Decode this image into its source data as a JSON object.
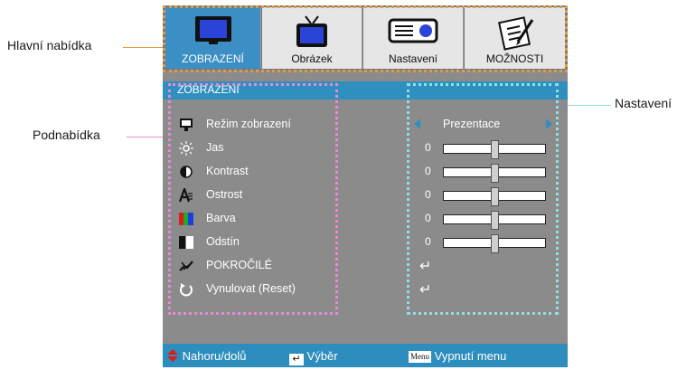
{
  "callouts": {
    "main_menu": "Hlavní nabídka",
    "submenu": "Podnabídka",
    "settings": "Nastavení"
  },
  "tabs": [
    {
      "label": "ZOBRAZENÍ",
      "icon": "monitor-icon",
      "active": true
    },
    {
      "label": "Obrázek",
      "icon": "tv-icon",
      "active": false
    },
    {
      "label": "Nastavení",
      "icon": "projector-icon",
      "active": false
    },
    {
      "label": "MOŽNOSTI",
      "icon": "notepad-pen-icon",
      "active": false
    }
  ],
  "section_title": "ZOBRAZENÍ",
  "rows": [
    {
      "label": "Režim zobrazení",
      "icon": "monitor-small-icon",
      "value": "Prezentace",
      "type": "select"
    },
    {
      "label": "Jas",
      "icon": "sun-icon",
      "value": "0",
      "type": "slider",
      "level": 0.5
    },
    {
      "label": "Kontrast",
      "icon": "contrast-icon",
      "value": "0",
      "type": "slider",
      "level": 0.5
    },
    {
      "label": "Ostrost",
      "icon": "sharpness-icon",
      "value": "0",
      "type": "slider",
      "level": 0.5
    },
    {
      "label": "Barva",
      "icon": "color-bars-icon",
      "value": "0",
      "type": "slider",
      "level": 0.5
    },
    {
      "label": "Odstín",
      "icon": "tint-icon",
      "value": "0",
      "type": "slider",
      "level": 0.5
    },
    {
      "label": "POKROČILÉ",
      "icon": "advanced-icon",
      "type": "enter"
    },
    {
      "label": "Vynulovat (Reset)",
      "icon": "reset-icon",
      "type": "enter"
    }
  ],
  "footer": {
    "nav": "Nahoru/dolů",
    "select": "Výběr",
    "menu_key": "Menu",
    "exit": "Vypnutí menu"
  },
  "colors": {
    "accent": "#2f8fbf",
    "panel": "#8b8b8b",
    "orange_frame": "#e39b43",
    "pink_frame": "#e88ad8",
    "cyan_frame": "#8fdfe3"
  }
}
